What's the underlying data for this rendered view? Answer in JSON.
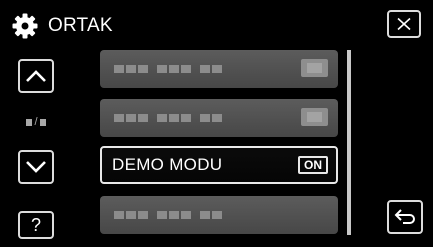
{
  "header": {
    "icon": "gear-icon",
    "title": "ORTAK"
  },
  "buttons": {
    "close_icon": "close-icon",
    "up_icon": "chevron-up-icon",
    "down_icon": "chevron-down-icon",
    "help_label": "?",
    "back_icon": "return-arrow-icon"
  },
  "page_indicator": {
    "icon": "page-indicator-icon"
  },
  "menu": {
    "items": [
      {
        "label": "",
        "value": "",
        "state": "dimmed"
      },
      {
        "label": "",
        "value": "",
        "state": "dimmed"
      },
      {
        "label": "DEMO MODU",
        "value": "ON",
        "state": "active"
      },
      {
        "label": "",
        "value": "",
        "state": "dimmed"
      }
    ]
  },
  "colors": {
    "background": "#000000",
    "item_dimmed": "#535353",
    "item_active_border": "#e8e8e8",
    "text": "#ffffff"
  }
}
